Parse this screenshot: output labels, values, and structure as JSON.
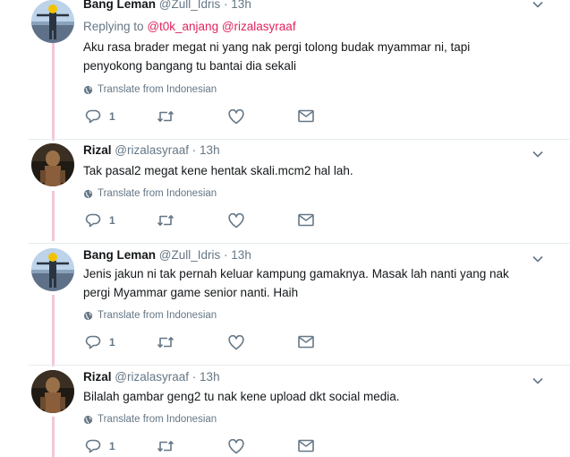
{
  "tweets": [
    {
      "author_name": "Bang Leman",
      "author_handle": "@Zull_Idris",
      "separator": "·",
      "time": "13h",
      "replying_prefix": "Replying to",
      "replying_handles": [
        "@t0k_anjang",
        "@rizalasyraaf"
      ],
      "text_lines": [
        "Aku rasa brader megat ni yang nak pergi tolong budak myammar ni, tapi",
        "penyokong bangang tu bantai dia sekali"
      ],
      "translate_label": "Translate from Indonesian",
      "reply_count": "1"
    },
    {
      "author_name": "Rizal",
      "author_handle": "@rizalasyraaf",
      "separator": "·",
      "time": "13h",
      "text_lines": [
        "Tak pasal2 megat kene hentak skali.mcm2 hal lah."
      ],
      "translate_label": "Translate from Indonesian",
      "reply_count": "1"
    },
    {
      "author_name": "Bang Leman",
      "author_handle": "@Zull_Idris",
      "separator": "·",
      "time": "13h",
      "text_lines": [
        "Jenis jakun ni tak pernah keluar kampung gamaknya. Masak lah nanti yang nak",
        "pergi Myammar game senior nanti. Haih"
      ],
      "translate_label": "Translate from Indonesian",
      "reply_count": "1"
    },
    {
      "author_name": "Rizal",
      "author_handle": "@rizalasyraaf",
      "separator": "·",
      "time": "13h",
      "text_lines": [
        "Bilalah gambar geng2 tu nak kene upload dkt social media."
      ],
      "translate_label": "Translate from Indonesian",
      "reply_count": "1"
    }
  ],
  "icons": {
    "reply": "reply-icon",
    "retweet": "retweet-icon",
    "like": "heart-icon",
    "message": "envelope-icon",
    "globe": "globe-icon",
    "more": "chevron-down-icon"
  },
  "colors": {
    "thread_line": "#f4c5d9",
    "link": "#e0245e",
    "muted": "#657786",
    "text": "#14171a"
  }
}
